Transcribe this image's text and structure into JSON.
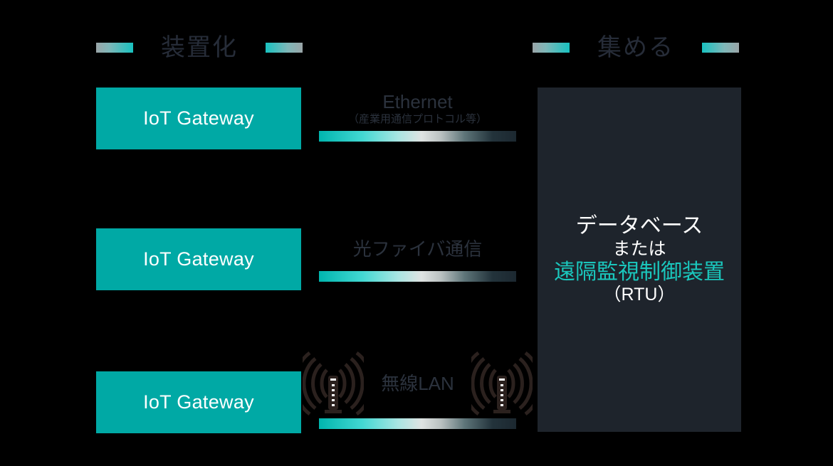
{
  "headers": {
    "left": {
      "title": "装置化"
    },
    "right": {
      "title": "集める"
    }
  },
  "gateways": [
    {
      "label": "IoT Gateway"
    },
    {
      "label": "IoT Gateway"
    },
    {
      "label": "IoT Gateway"
    }
  ],
  "links": [
    {
      "title": "Ethernet",
      "subtitle": "（産業用通信プロトコル等）"
    },
    {
      "title": "光ファイバ通信",
      "subtitle": ""
    },
    {
      "title": "無線LAN",
      "subtitle": ""
    }
  ],
  "panel": {
    "line1": "データベース",
    "line2": "または",
    "line3": "遠隔監視制御装置",
    "line4": "（RTU）"
  },
  "colors": {
    "background": "#000000",
    "gateway_fill": "#00a9a5",
    "gateway_text": "#ffffff",
    "header_text": "#262c38",
    "link_text": "#2b323d",
    "panel_fill": "#1e242c",
    "panel_text": "#ffffff",
    "panel_accent": "#1ac7bd",
    "bar_teal": "#00b5ae",
    "bar_dark": "#1c2830",
    "router_icon": "#2b211e"
  },
  "icons": {
    "router": "wireless-router-icon",
    "deco_left": "deco-bar-icon",
    "deco_right": "deco-bar-icon"
  }
}
